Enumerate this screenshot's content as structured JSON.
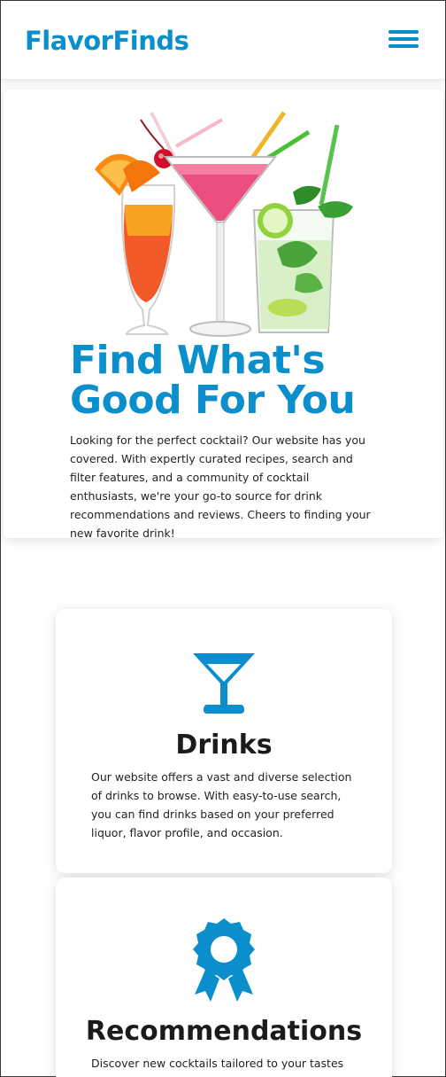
{
  "header": {
    "logo": "FlavorFinds",
    "menu_icon": "hamburger-menu-icon"
  },
  "hero": {
    "image_alt": "three-cocktails",
    "title": "Find What's Good For You",
    "text": "Looking for the perfect cocktail? Our website has you covered. With expertly curated recipes, search and filter features, and a community of cocktail enthusiasts, we're your go-to source for drink recommendations and reviews. Cheers to finding your new favorite drink!"
  },
  "features": [
    {
      "icon": "cocktail-glass-icon",
      "title": "Drinks",
      "text": "Our website offers a vast and diverse selection of drinks to browse. With easy-to-use search, you can find drinks based on your preferred liquor, flavor profile, and occasion."
    },
    {
      "icon": "award-ribbon-icon",
      "title": "Recommendations",
      "text": "Discover new cocktails tailored to your tastes with"
    }
  ],
  "colors": {
    "brand": "#0b8fcc",
    "heading": "#1b1b1b",
    "body_text": "#222222"
  }
}
